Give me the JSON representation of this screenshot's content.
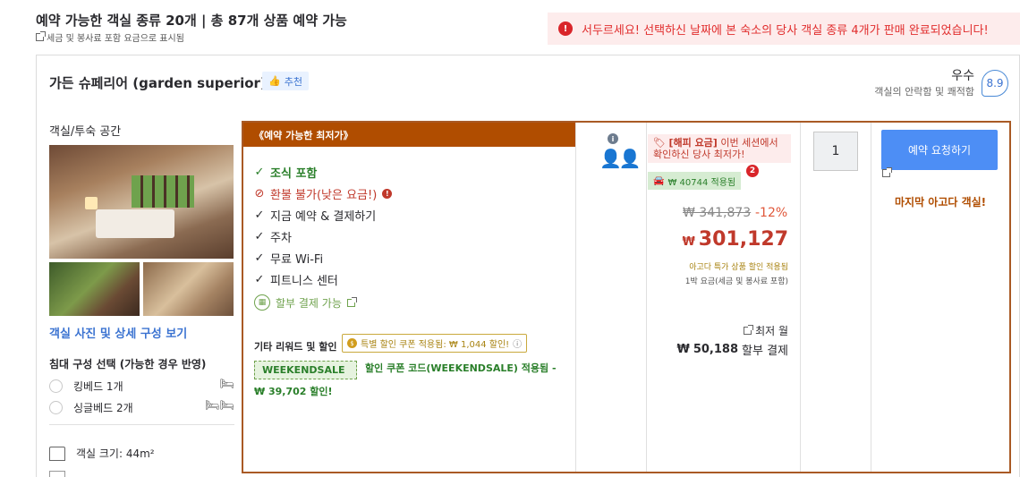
{
  "header": {
    "title": "예약 가능한 객실 종류 20개 | 총 87개 상품 예약 가능",
    "subtitle": "세금 및 봉사료 포함 요금으로 표시됨",
    "alert": "서두르세요! 선택하신 날짜에 본 숙소의 당사 객실 종류 4개가 판매 완료되었습니다!"
  },
  "room": {
    "name": "가든 슈페리어 (garden superior)",
    "recommend": "추천",
    "rating_label": "우수",
    "rating_desc": "객실의 안락함 및 쾌적함",
    "rating_score": "8.9",
    "space_label": "객실/투숙 공간",
    "photo_link": "객실 사진 및 상세 구성 보기",
    "bed_title": "침대 구성 선택 (가능한 경우 반영)",
    "beds": [
      "킹베드 1개",
      "싱글베드 2개"
    ],
    "size": "객실 크기: 44m²"
  },
  "offer": {
    "header": "《예약 가능한 최저가》",
    "features": [
      {
        "label": "조식 포함",
        "style": "green",
        "mark": "✓"
      },
      {
        "label": "환불 불가(낮은 요금!)",
        "style": "red",
        "mark": "⊘"
      },
      {
        "label": "지금 예약 & 결제하기",
        "style": "plain",
        "mark": "✓"
      },
      {
        "label": "주차",
        "style": "plain",
        "mark": "✓"
      },
      {
        "label": "무료 Wi-Fi",
        "style": "plain",
        "mark": "✓"
      },
      {
        "label": "피트니스 센터",
        "style": "plain",
        "mark": "✓"
      }
    ],
    "installment": "할부 결제 가능",
    "other_label": "기타 리워드 및 할인",
    "coupon_chip": "특별 할인 쿠폰 적용됨: ₩ 1,044 할인!",
    "ws_code": "WEEKENDSALE",
    "ws_text": "할인 쿠폰 코드(WEEKENDSALE) 적용됨 -",
    "ws_amount": "₩ 39,702 할인!"
  },
  "pricing": {
    "happy_title": "[해피 요금]",
    "happy_text": "이번 세션에서 확인하신 당사 최저가!",
    "badge": "2",
    "applied": "₩ 40744 적용됨",
    "original": "₩ 341,873",
    "discount_pct": "-12%",
    "currency": "₩",
    "price": "301,127",
    "note1": "아고다 특가 상품 할인 적용됨",
    "note2": "1박 요금(세금 및 봉사료 포함)",
    "min_label": "최저 월",
    "inst_currency": "₩",
    "inst_amount": "50,188",
    "inst_suffix": "할부 결제"
  },
  "booking": {
    "qty": "1",
    "button": "예약 요청하기",
    "last_room": "마지막 아고다 객실!"
  },
  "colors": {
    "accent": "#4d8ef5",
    "offer_header": "#b04d00",
    "price_red": "#c0392b",
    "green": "#2a7f2a"
  }
}
